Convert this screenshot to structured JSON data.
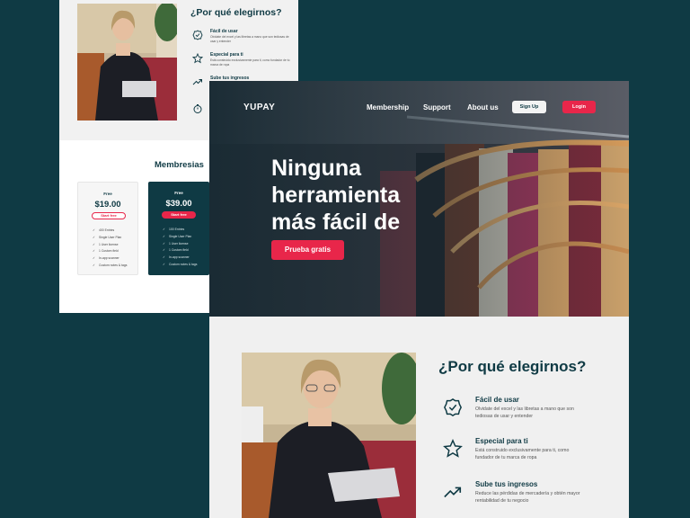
{
  "back": {
    "why_title": "¿Por qué elegirnos?",
    "features": [
      {
        "icon": "badge-check-icon",
        "title": "Fácil de usar",
        "desc": "Olvidate del excel y las libretas a mano que son tediosas de usar y entender"
      },
      {
        "icon": "star-icon",
        "title": "Especial para ti",
        "desc": "Está construido exclusivamente para ti, como fundador de tu marca de ropa"
      },
      {
        "icon": "trending-up-icon",
        "title": "Sube tus ingresos",
        "desc": ""
      },
      {
        "icon": "stopwatch-icon",
        "title": "",
        "desc": ""
      }
    ],
    "memberships_title": "Membresias",
    "plans": [
      {
        "name": "Free",
        "price": "$19.00",
        "button": "Start free",
        "items": [
          "400 Entries",
          "Single User Plan",
          "1 User license",
          "1 Custom field",
          "In-app scanner",
          "Custom notes & tags"
        ]
      },
      {
        "name": "Free",
        "price": "$39.00",
        "button": "Start free",
        "items": [
          "100 Entries",
          "Single User Plan",
          "1 User license",
          "1 Custom field",
          "In-app scanner",
          "Custom notes & tags"
        ]
      }
    ]
  },
  "front": {
    "logo": "YUPAY",
    "nav": {
      "membership": "Membership",
      "support": "Support",
      "about": "About us"
    },
    "signup": "Sign Up",
    "login": "Login",
    "hero_title": "Ninguna herramienta más fácil de usar",
    "cta": "Prueba gratis",
    "why_title": "¿Por qué elegirnos?",
    "features": [
      {
        "icon": "badge-check-icon",
        "title": "Fácil de usar",
        "desc": "Olvidate del excel y las libretas a mano que son tediosas de usar y entender"
      },
      {
        "icon": "star-icon",
        "title": "Especial para ti",
        "desc": "Está construido exclusivamente para ti, como fundador de tu marca de ropa"
      },
      {
        "icon": "trending-up-icon",
        "title": "Sube tus ingresos",
        "desc": "Reduce las pérdidas de mercadería y obtén mayor rentabilidad de tu negocio"
      }
    ]
  },
  "colors": {
    "brand_dark": "#0f3a44",
    "accent": "#e8264a",
    "surface": "#f0f0f0"
  }
}
